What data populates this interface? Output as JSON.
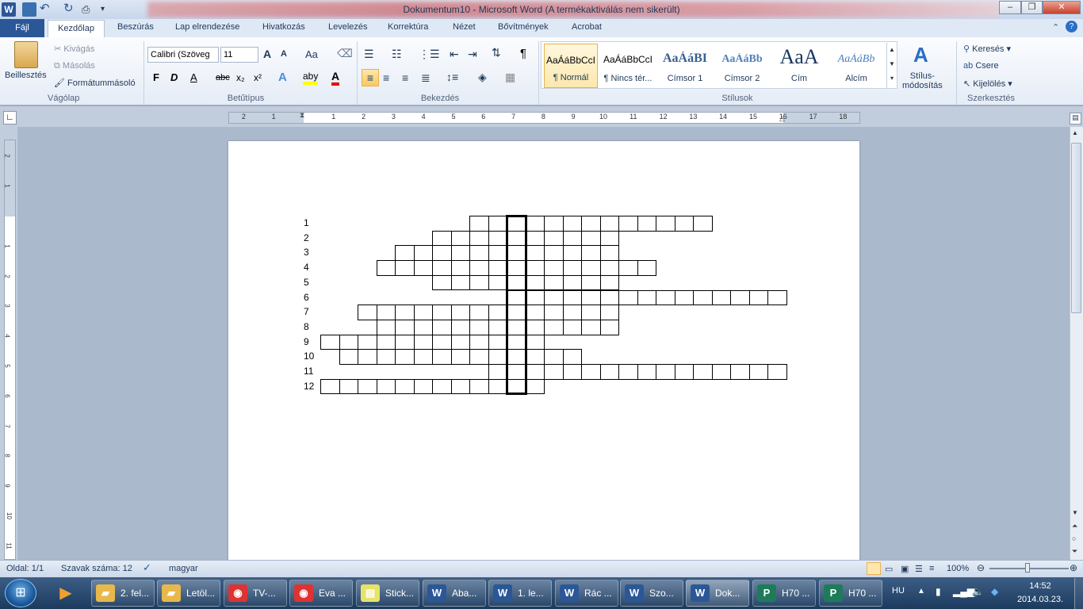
{
  "window": {
    "title": "Dokumentum10  -  Microsoft Word (A termékaktiválás nem sikerült)"
  },
  "quick_access": {
    "icons": [
      "word-icon",
      "save-icon",
      "undo-icon",
      "redo-icon",
      "print-icon",
      "customize-icon"
    ]
  },
  "tabs": {
    "file": "Fájl",
    "items": [
      "Kezdőlap",
      "Beszúrás",
      "Lap elrendezése",
      "Hivatkozás",
      "Levelezés",
      "Korrektúra",
      "Nézet",
      "Bővítmények",
      "Acrobat"
    ],
    "active": "Kezdőlap"
  },
  "clipboard": {
    "paste": "Beillesztés",
    "cut": "Kivágás",
    "copy": "Másolás",
    "format_painter": "Formátummásoló",
    "group": "Vágólap"
  },
  "font": {
    "family": "Calibri (Szöveg",
    "size": "11",
    "group": "Betűtípus",
    "grow": "A",
    "shrink": "A",
    "case": "Aa",
    "bold": "F",
    "italic": "D",
    "underline": "A",
    "strike": "abc",
    "subscript": "x₂",
    "superscript": "x²",
    "highlight": "aby",
    "color": "A"
  },
  "paragraph": {
    "group": "Bekezdés",
    "pilcrow": "¶"
  },
  "styles": {
    "group": "Stílusok",
    "items": [
      {
        "sample": "AaÁáBbCcI",
        "name": "¶ Normál"
      },
      {
        "sample": "AaÁáBbCcI",
        "name": "¶ Nincs tér..."
      },
      {
        "sample": "AaÁáBI",
        "name": "Címsor 1"
      },
      {
        "sample": "AaÁáBb",
        "name": "Címsor 2"
      },
      {
        "sample": "AaA",
        "name": "Cím"
      },
      {
        "sample": "AaÁáBb",
        "name": "Alcím"
      }
    ],
    "change": "Stílus-\nmódosítás"
  },
  "editing": {
    "group": "Szerkesztés",
    "find": "Keresés",
    "replace": "Csere",
    "select": "Kijelölés"
  },
  "ruler": {
    "h_ticks": [
      "2",
      "1",
      "1",
      "2",
      "3",
      "4",
      "5",
      "6",
      "7",
      "8",
      "9",
      "10",
      "11",
      "12",
      "13",
      "14",
      "15",
      "16",
      "17",
      "18"
    ],
    "v_ticks": [
      "2",
      "1",
      "1",
      "2",
      "3",
      "4",
      "5",
      "6",
      "7",
      "8",
      "9",
      "10",
      "11"
    ]
  },
  "crossword": {
    "row_numbers": [
      "1",
      "2",
      "3",
      "4",
      "5",
      "6",
      "7",
      "8",
      "9",
      "10",
      "11",
      "12"
    ],
    "solution_column": 10,
    "rows": [
      {
        "start": 8,
        "count": 13
      },
      {
        "start": 6,
        "count": 10
      },
      {
        "start": 4,
        "count": 12
      },
      {
        "start": 3,
        "count": 15
      },
      {
        "start": 6,
        "count": 10
      },
      {
        "start": 10,
        "count": 15
      },
      {
        "start": 2,
        "count": 14
      },
      {
        "start": 3,
        "count": 13
      },
      {
        "start": 0,
        "count": 12
      },
      {
        "start": 1,
        "count": 13
      },
      {
        "start": 9,
        "count": 16
      },
      {
        "start": 0,
        "count": 12
      }
    ]
  },
  "status": {
    "page": "Oldal: 1/1",
    "words": "Szavak száma: 12",
    "language": "magyar",
    "zoom": "100%"
  },
  "taskbar": {
    "items": [
      {
        "label": "2. fel...",
        "icon": "folder-icon",
        "color": "#e8b94a"
      },
      {
        "label": "Letöl...",
        "icon": "folder-icon",
        "color": "#e8b94a"
      },
      {
        "label": "TV-...",
        "icon": "chrome-icon",
        "color": "#d33"
      },
      {
        "label": "Eva ...",
        "icon": "chrome-icon",
        "color": "#d33"
      },
      {
        "label": "Stick...",
        "icon": "sticky-notes-icon",
        "color": "#e6e36a"
      },
      {
        "label": "Aba...",
        "icon": "word-icon",
        "color": "#2b5797"
      },
      {
        "label": "1. le...",
        "icon": "word-icon",
        "color": "#2b5797"
      },
      {
        "label": "Rác ...",
        "icon": "word-icon",
        "color": "#2b5797"
      },
      {
        "label": "Szo...",
        "icon": "word-icon",
        "color": "#2b5797"
      },
      {
        "label": "Dok...",
        "icon": "word-icon",
        "color": "#2b5797"
      },
      {
        "label": "H70 ...",
        "icon": "publisher-icon",
        "color": "#1e7b5a"
      },
      {
        "label": "H70 ...",
        "icon": "publisher-icon",
        "color": "#1e7b5a"
      }
    ],
    "lang": "HU",
    "time": "14:52",
    "date": "2014.03.23."
  },
  "colors": {
    "accent": "#2b5797",
    "ribbon": "#e5ecf6",
    "taskbar": "#1b3a5e"
  }
}
